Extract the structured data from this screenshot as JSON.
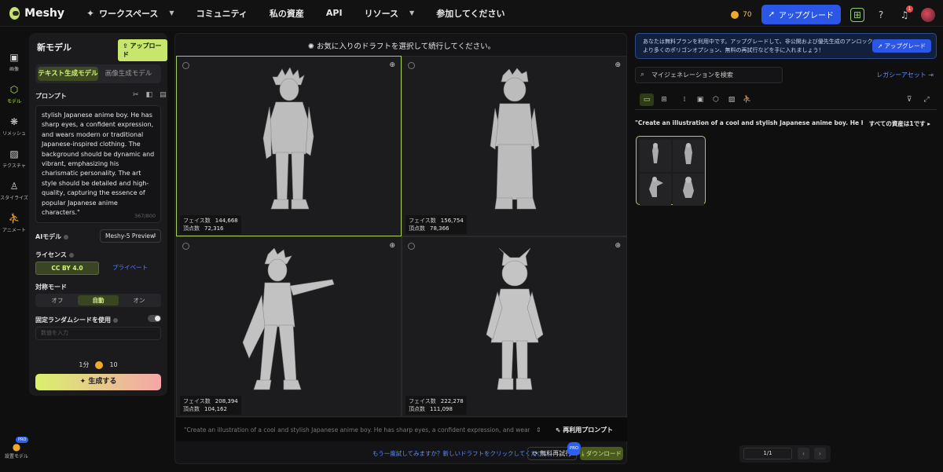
{
  "topbar": {
    "brand": "Meshy",
    "nav": [
      {
        "label": "ワークスペース"
      },
      {
        "label": "コミュニティ"
      },
      {
        "label": "私の資産"
      },
      {
        "label": "API"
      },
      {
        "label": "リソース"
      },
      {
        "label": "参加してください"
      }
    ],
    "credits": "70",
    "upgrade": "アップグレード",
    "notifications": "1"
  },
  "rail": {
    "items": [
      "画像",
      "モデル",
      "リメッシュ",
      "テクスチャ",
      "スタイライズ",
      "アニメート"
    ],
    "active_index": 1,
    "bottom_label": "設置モデル",
    "bottom_badge": "PRO"
  },
  "panel": {
    "title": "新モデル",
    "upload": "アップロード",
    "tabs": [
      "テキスト生成モデル",
      "画像生成モデル"
    ],
    "prompt_label": "プロンプト",
    "prompt_text": "stylish Japanese anime boy. He has sharp eyes, a confident expression, and wears modern or traditional Japanese-inspired clothing. The background should be dynamic and vibrant, emphasizing his charismatic personality. The art style should be detailed and high-quality, capturing the essence of popular Japanese anime characters.\"",
    "char_count": "367/800",
    "ai_label": "AIモデル",
    "ai_value": "Meshy-5 Preview",
    "license_label": "ライセンス",
    "license_options": [
      "CC BY 4.0",
      "プライベート"
    ],
    "symmetry_label": "対称モード",
    "symmetry_options": [
      "オフ",
      "自動",
      "オン"
    ],
    "seed_label": "固定ランダムシードを使用",
    "seed_placeholder": "数値を入力",
    "time": "1分",
    "cost": "10",
    "generate": "生成する"
  },
  "center": {
    "hint": "お気に入りのドラフトを選択して続行してください。",
    "drafts": [
      {
        "faces": "144,668",
        "verts": "72,316",
        "selected": true
      },
      {
        "faces": "156,754",
        "verts": "78,366",
        "selected": false
      },
      {
        "faces": "208,394",
        "verts": "104,162",
        "selected": false
      },
      {
        "faces": "222,278",
        "verts": "111,098",
        "selected": false
      }
    ],
    "faces_label": "フェイス数",
    "verts_label": "頂点数",
    "prompt_preview": "\"Create an illustration of a cool and stylish Japanese anime boy. He has sharp eyes, a confident expression, and wears modern or tr...",
    "reuse": "再利用プロンプト",
    "retry_text": "もう一度試してみますか？新しいドラフトをクリックしてください。",
    "retry_btn": "無料再試行",
    "retry_badge": "PRO",
    "download": "ダウンロード"
  },
  "right": {
    "banner_text": "あなたは無料プランを利用中です。アップグレードして、非公開および優先生成のアンロック、より多くのポリゴンオプション、無料の再試行などを手に入れましょう！",
    "banner_btn": "アップグレード",
    "search_placeholder": "マイジェネレーションを検索",
    "legacy": "レガシーアセット",
    "asset_prompt": "\"Create an illustration of a cool and stylish Japanese anime boy. He has sharp eyes,...",
    "asset_count": "すべての資産は1です",
    "page": "1/1"
  }
}
